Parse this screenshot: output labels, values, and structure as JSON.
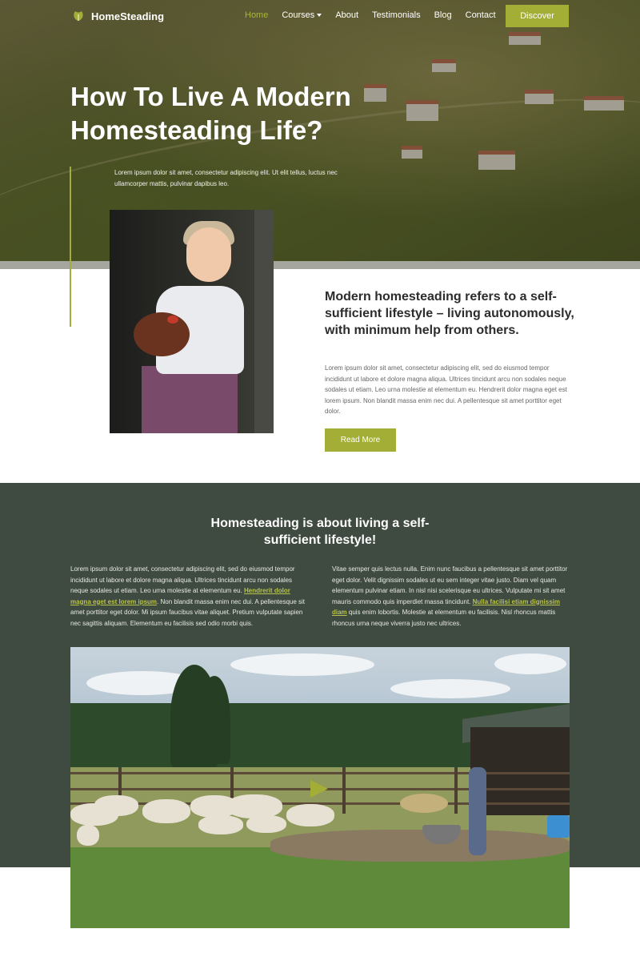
{
  "brand": {
    "name": "HomeSteading",
    "accent_color": "#a3ae36",
    "dark_section_color": "#3f4a40"
  },
  "nav": {
    "items": [
      {
        "label": "Home",
        "active": true
      },
      {
        "label": "Courses",
        "has_dropdown": true
      },
      {
        "label": "About"
      },
      {
        "label": "Testimonials"
      },
      {
        "label": "Blog"
      },
      {
        "label": "Contact"
      }
    ],
    "cta_label": "Discover"
  },
  "hero": {
    "title": "How To Live A Modern Homesteading Life?",
    "subtitle": "Lorem ipsum dolor sit amet, consectetur adipiscing elit. Ut elit tellus, luctus nec ullamcorper mattis, pulvinar dapibus leo."
  },
  "intro": {
    "heading": "Modern homesteading refers to a self-sufficient lifestyle – living autonomously, with minimum help from others.",
    "body": "Lorem ipsum dolor sit amet, consectetur adipiscing elit, sed do eiusmod tempor incididunt ut labore et dolore magna aliqua. Ultrices tincidunt arcu non sodales neque sodales ut etiam. Leo urna molestie at elementum eu. Hendrerit dolor magna eget est lorem ipsum. Non blandit massa enim nec dui. A pellentesque sit amet porttitor eget dolor.",
    "button_label": "Read More"
  },
  "lifestyle": {
    "heading": "Homesteading is about living a self-sufficient lifestyle!",
    "left": {
      "before": "Lorem ipsum dolor sit amet, consectetur adipiscing elit, sed do eiusmod tempor incididunt ut labore et dolore magna aliqua. Ultrices tincidunt arcu non sodales neque sodales ut etiam. Leo urna molestie at elementum eu. ",
      "link": "Hendrerit dolor magna eget est lorem ipsum",
      "after": ". Non blandit massa enim nec dui. A pellentesque sit amet porttitor eget dolor. Mi ipsum faucibus vitae aliquet. Pretium vulputate sapien nec sagittis aliquam. Elementum eu facilisis sed odio morbi quis."
    },
    "right": {
      "before": "Vitae semper quis lectus nulla. Enim nunc faucibus a pellentesque sit amet porttitor eget dolor. Velit dignissim sodales ut eu sem integer vitae justo. Diam vel quam elementum pulvinar etiam. In nisl nisi scelerisque eu ultrices. Vulputate mi sit amet mauris commodo quis imperdiet massa tincidunt. ",
      "link": "Nulla facilisi etiam dignissim diam",
      "after": " quis enim lobortis. Molestie at elementum eu facilisis. Nisl rhoncus mattis rhoncus urna neque viverra justo nec ultrices."
    }
  },
  "icons": {
    "logo": "leaf-icon",
    "nav_dropdown": "chevron-down-icon",
    "video": "play-icon"
  }
}
